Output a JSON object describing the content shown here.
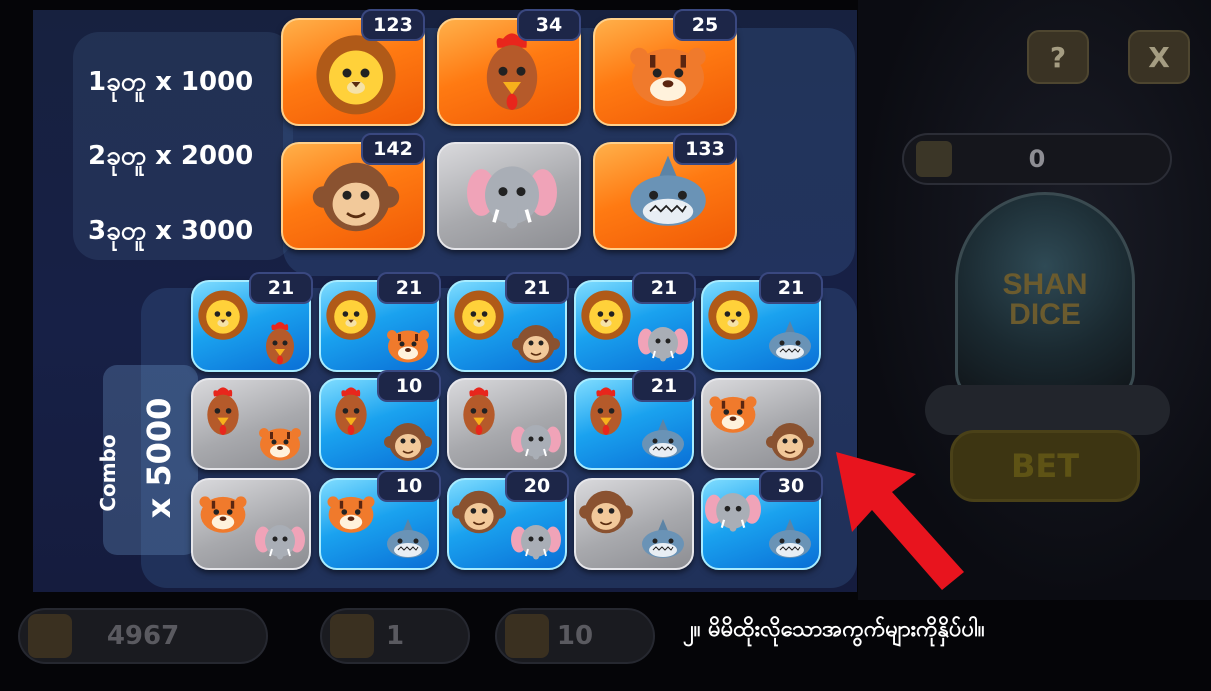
{
  "multipliers": [
    {
      "label": "1ခုတူ x 1000"
    },
    {
      "label": "2ခုတူ x 2000"
    },
    {
      "label": "3ခုတူ x 3000"
    }
  ],
  "single_tiles": [
    {
      "animal": "lion",
      "style": "orange",
      "count": "123",
      "icon": "lion-icon"
    },
    {
      "animal": "rooster",
      "style": "orange",
      "count": "34",
      "icon": "rooster-icon"
    },
    {
      "animal": "tiger",
      "style": "orange",
      "count": "25",
      "icon": "tiger-icon"
    },
    {
      "animal": "monkey",
      "style": "orange",
      "count": "142",
      "icon": "monkey-icon"
    },
    {
      "animal": "elephant",
      "style": "gray",
      "count": "",
      "icon": "elephant-icon"
    },
    {
      "animal": "shark",
      "style": "orange",
      "count": "133",
      "icon": "shark-icon"
    }
  ],
  "combo": {
    "label": "Combo",
    "multiplier": "x 5000",
    "tiles": [
      {
        "a": "lion",
        "b": "rooster",
        "style": "blue",
        "count": "21"
      },
      {
        "a": "lion",
        "b": "tiger",
        "style": "blue",
        "count": "21"
      },
      {
        "a": "lion",
        "b": "monkey",
        "style": "blue",
        "count": "21"
      },
      {
        "a": "lion",
        "b": "elephant",
        "style": "blue",
        "count": "21"
      },
      {
        "a": "lion",
        "b": "shark",
        "style": "blue",
        "count": "21"
      },
      {
        "a": "rooster",
        "b": "tiger",
        "style": "gray",
        "count": ""
      },
      {
        "a": "rooster",
        "b": "monkey",
        "style": "blue",
        "count": "10"
      },
      {
        "a": "rooster",
        "b": "elephant",
        "style": "gray",
        "count": ""
      },
      {
        "a": "rooster",
        "b": "shark",
        "style": "blue",
        "count": "21"
      },
      {
        "a": "tiger",
        "b": "monkey",
        "style": "gray",
        "count": ""
      },
      {
        "a": "tiger",
        "b": "elephant",
        "style": "gray",
        "count": ""
      },
      {
        "a": "tiger",
        "b": "shark",
        "style": "blue",
        "count": "10"
      },
      {
        "a": "monkey",
        "b": "elephant",
        "style": "blue",
        "count": "20"
      },
      {
        "a": "monkey",
        "b": "shark",
        "style": "gray",
        "count": ""
      },
      {
        "a": "elephant",
        "b": "shark",
        "style": "blue",
        "count": "30"
      }
    ]
  },
  "background": {
    "help_label": "?",
    "close_label": "X",
    "balance_value": "0",
    "bet_label": "BET",
    "dice_logo": "SHAN DICE",
    "bottom_values": [
      "4967",
      "1",
      "10"
    ]
  },
  "instruction": "၂။ မိမိထိုးလိုသောအကွက်များကိုနှိပ်ပါ။",
  "colors": {
    "orange": "#ff7a12",
    "blue": "#1aa2ef",
    "gray": "#a8a9ad",
    "arrow": "#e8141e",
    "panel": "#172046"
  }
}
